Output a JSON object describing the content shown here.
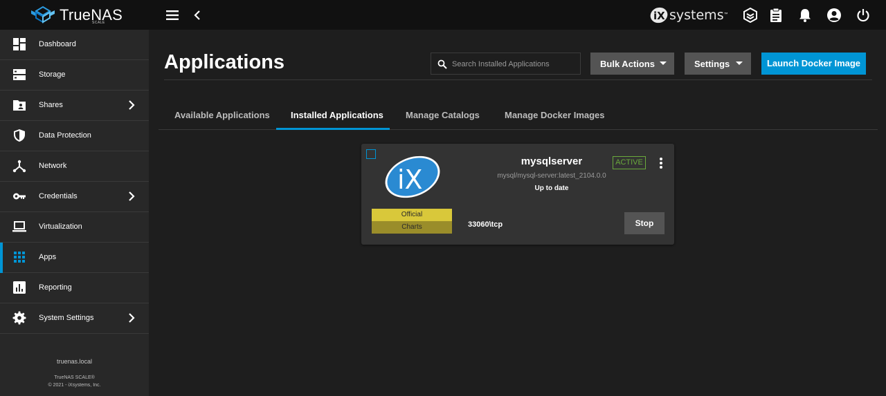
{
  "brand": {
    "name": "TrueNAS",
    "edition": "SCALE"
  },
  "vendor": {
    "logo_text": "systems",
    "logo_mark": "iX",
    "trademark": "™"
  },
  "topbar": {
    "icons": [
      "menu-icon",
      "chevron-left-icon",
      "truecommand-icon",
      "clipboard-icon",
      "bell-icon",
      "account-icon",
      "power-icon"
    ]
  },
  "sidebar": {
    "items": [
      {
        "label": "Dashboard",
        "icon": "dashboard-icon",
        "has_submenu": false,
        "active": false
      },
      {
        "label": "Storage",
        "icon": "storage-icon",
        "has_submenu": false,
        "active": false
      },
      {
        "label": "Shares",
        "icon": "shares-icon",
        "has_submenu": true,
        "active": false
      },
      {
        "label": "Data Protection",
        "icon": "shield-icon",
        "has_submenu": false,
        "active": false
      },
      {
        "label": "Network",
        "icon": "network-icon",
        "has_submenu": false,
        "active": false
      },
      {
        "label": "Credentials",
        "icon": "key-icon",
        "has_submenu": true,
        "active": false
      },
      {
        "label": "Virtualization",
        "icon": "laptop-icon",
        "has_submenu": false,
        "active": false
      },
      {
        "label": "Apps",
        "icon": "apps-grid-icon",
        "has_submenu": false,
        "active": true
      },
      {
        "label": "Reporting",
        "icon": "chart-icon",
        "has_submenu": false,
        "active": false
      },
      {
        "label": "System Settings",
        "icon": "gear-icon",
        "has_submenu": true,
        "active": false
      }
    ],
    "hostname": "truenas.local",
    "version_line": "TrueNAS SCALE®",
    "copyright": "© 2021 - iXsystems, Inc."
  },
  "page": {
    "title": "Applications",
    "search_placeholder": "Search Installed Applications",
    "bulk_actions_label": "Bulk Actions",
    "settings_label": "Settings",
    "launch_label": "Launch Docker Image"
  },
  "tabs": [
    {
      "label": "Available Applications",
      "active": false
    },
    {
      "label": "Installed Applications",
      "active": true
    },
    {
      "label": "Manage Catalogs",
      "active": false
    },
    {
      "label": "Manage Docker Images",
      "active": false
    }
  ],
  "app_card": {
    "name": "mysqlserver",
    "image": "mysql/mysql-server:latest_2104.0.0",
    "update_status": "Up to date",
    "status": "ACTIVE",
    "catalog_line1": "Official",
    "catalog_line2": "Charts",
    "ports": "33060\\tcp",
    "stop_label": "Stop",
    "logo_text": "iX"
  },
  "colors": {
    "accent": "#0095d5",
    "active_status": "#6aaa3c",
    "official_badge": "#d9c83a",
    "charts_badge": "#9a8d2a"
  }
}
